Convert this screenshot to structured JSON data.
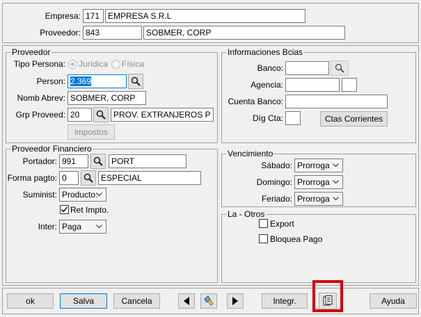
{
  "top": {
    "empresa_label": "Empresa:",
    "empresa_code": "171",
    "empresa_name": "EMPRESA S.R.L",
    "proveedor_label": "Proveedor:",
    "proveedor_code": "843",
    "proveedor_name": "SOBMER, CORP"
  },
  "proveedor": {
    "legend": "Proveedor",
    "tipo_persona_label": "Tipo Persona:",
    "juridica_label": "Jurídica",
    "fisica_label": "Física",
    "person_label": "Person:",
    "person_value": "2.369",
    "nomb_abrev_label": "Nomb Abrev:",
    "nomb_abrev_value": "SOBMER, CORP",
    "grp_proveed_label": "Grp Proveed:",
    "grp_proveed_code": "20",
    "grp_proveed_name": "PROV. EXTRANJEROS  P",
    "impostos_label": "impostos"
  },
  "financiero": {
    "legend": "Proveedor Financiero",
    "portador_label": "Portador:",
    "portador_code": "991",
    "portador_name": "PORT",
    "forma_pagto_label": "Forma pagto:",
    "forma_pagto_code": "0",
    "forma_pagto_name": "ESPECIAL",
    "suminist_label": "Suminist:",
    "suminist_value": "Producto:",
    "ret_impto_label": "Ret Impto.",
    "inter_label": "Inter:",
    "inter_value": "Paga"
  },
  "bancos": {
    "legend": "Informaciones Bcias",
    "banco_label": "Banco:",
    "agencia_label": "Agencia:",
    "cuenta_label": "Cuenta Banco:",
    "dig_cta_label": "Díg Cta:",
    "ctas_corrientes_label": "Ctas Corrientes"
  },
  "vencimiento": {
    "legend": "Vencimiento",
    "sabado_label": "Sábado:",
    "sabado_value": "Prorroga",
    "domingo_label": "Domingo:",
    "domingo_value": "Prorroga",
    "feriado_label": "Feriado:",
    "feriado_value": "Prorroga"
  },
  "otros": {
    "legend": "La - Otros",
    "export_label": "Export",
    "bloquea_label": "Bloquea Pago"
  },
  "footer": {
    "ok_label": "ok",
    "salva_label": "Salva",
    "cancela_label": "Cancela",
    "integr_label": "Integr.",
    "ayuda_label": "Ayuda"
  },
  "colors": {
    "highlight_frame": "#d40000",
    "selection": "#0078d7"
  }
}
